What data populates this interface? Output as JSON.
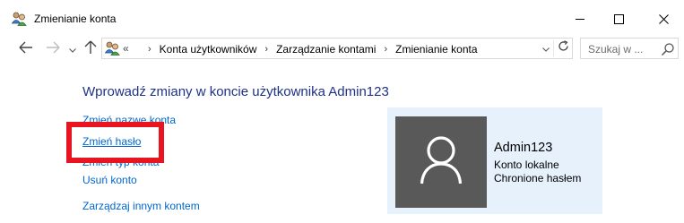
{
  "window": {
    "title": "Zmienianie konta",
    "icon": "user-accounts-icon",
    "controls": [
      "minimize-icon",
      "maximize-icon",
      "close-icon"
    ]
  },
  "navigation": {
    "breadcrumb_overflow": "«",
    "breadcrumbs": [
      "Konta użytkowników",
      "Zarządzanie kontami",
      "Zmienianie konta"
    ],
    "search_placeholder": "Szukaj w ..."
  },
  "main": {
    "heading": "Wprowadź zmiany w koncie użytkownika Admin123",
    "tasks": [
      "Zmień nazwę konta",
      "Zmień hasło",
      "Zmień typ konta",
      "Usuń konto",
      "Zarządzaj innym kontem"
    ],
    "highlighted_task_index": 1
  },
  "user": {
    "name": "Admin123",
    "account_type": "Konto lokalne",
    "protection": "Chronione hasłem",
    "avatar_icon": "user-silhouette-icon"
  },
  "colors": {
    "heading": "#1e3287",
    "link": "#0066cc",
    "highlight": "#e8141f",
    "card_background": "#e6f1fb",
    "avatar_background": "#595959"
  }
}
